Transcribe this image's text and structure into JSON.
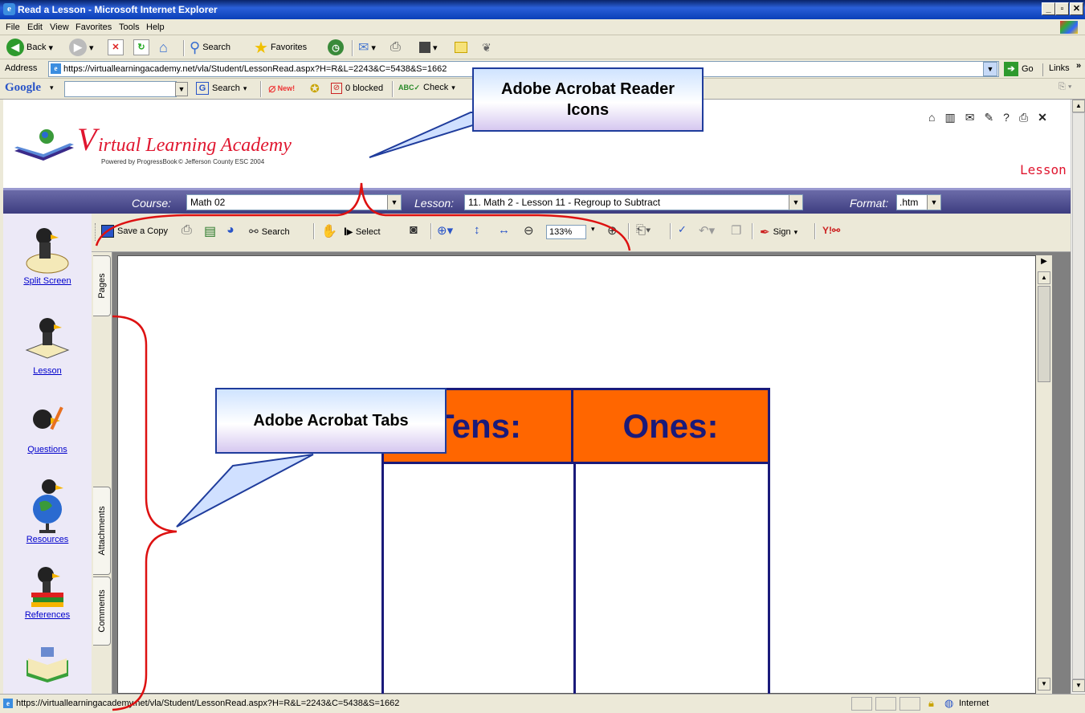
{
  "window": {
    "title": "Read a Lesson - Microsoft Internet Explorer"
  },
  "menu": [
    "File",
    "Edit",
    "View",
    "Favorites",
    "Tools",
    "Help"
  ],
  "navbar": {
    "back": "Back",
    "search": "Search",
    "favorites": "Favorites"
  },
  "address": {
    "label": "Address",
    "value": "https://virtuallearningacademy.net/vla/Student/LessonRead.aspx?H=R&L=2243&C=5438&S=1662",
    "go": "Go",
    "links": "Links"
  },
  "googlebar": {
    "brand": "Google",
    "search": "Search",
    "new_badge": "New!",
    "blocked": "0 blocked",
    "check": "Check"
  },
  "site": {
    "logo_title": "irtual Learning Academy",
    "logo_v": "V",
    "powered": "Powered by ProgressBook",
    "copyright": "© Jefferson County ESC 2004",
    "section": "Lesson"
  },
  "course": {
    "course_label": "Course:",
    "course_value": "Math 02",
    "lesson_label": "Lesson:",
    "lesson_value": "11. Math 2 - Lesson 11 - Regroup to Subtract",
    "format_label": "Format:",
    "format_value": ".htm"
  },
  "sidebar": [
    {
      "label": "Split Screen"
    },
    {
      "label": "Lesson"
    },
    {
      "label": "Questions"
    },
    {
      "label": "Resources"
    },
    {
      "label": "References"
    }
  ],
  "acrobat": {
    "save_copy": "Save a Copy",
    "search": "Search",
    "select": "Select",
    "zoom": "133%",
    "sign": "Sign"
  },
  "tabs": [
    "Pages",
    "Attachments",
    "Comments"
  ],
  "document": {
    "col_tens": "Tens:",
    "col_ones": "Ones:"
  },
  "callouts": {
    "icons": "Adobe Acrobat Reader Icons",
    "tabs": "Adobe Acrobat Tabs"
  },
  "status": {
    "url": "https://virtuallearningacademy.net/vla/Student/LessonRead.aspx?H=R&L=2243&C=5438&S=1662",
    "zone": "Internet"
  },
  "colors": {
    "title_bar": "#0A3FB8",
    "course_bar": "#3d3d80",
    "table_header": "#FF6600",
    "table_text": "#1a1a7a",
    "bracket": "#dd1111"
  }
}
